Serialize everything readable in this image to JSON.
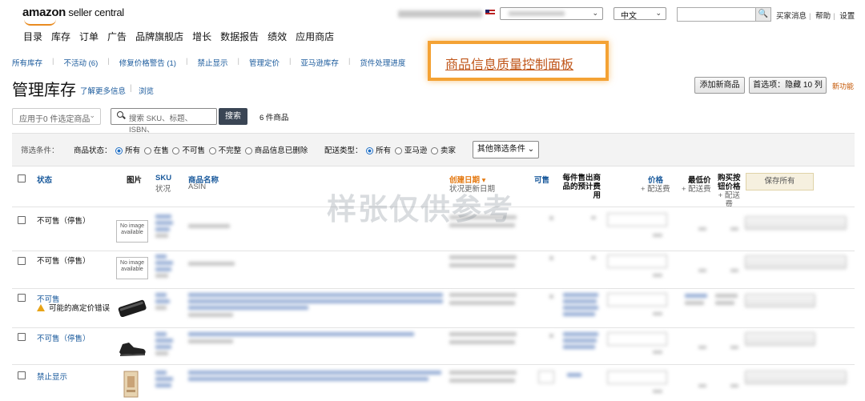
{
  "header": {
    "logo_main": "amazon",
    "logo_sub": " seller central",
    "nav": [
      "目录",
      "库存",
      "订单",
      "广告",
      "品牌旗舰店",
      "增长",
      "数据报告",
      "绩效",
      "应用商店"
    ],
    "lang_value": "中文",
    "top_links": [
      "买家消息",
      "帮助",
      "设置"
    ]
  },
  "subnav": [
    "所有库存",
    "不活动 (6)",
    "修复价格警告 (1)",
    "禁止显示",
    "管理定价",
    "亚马逊库存",
    "货件处理进度"
  ],
  "callout_text": "商品信息质量控制面板",
  "title": {
    "page_title": "管理库存",
    "learn_more": "了解更多信息",
    "browse": "浏览",
    "add_button": "添加新商品",
    "pref_button": "首选项：隐藏 10 列",
    "new_feature": "新功能"
  },
  "actions": {
    "apply_select": "应用于0 件选定商品",
    "search_placeholder": "搜索 SKU、标题、ISBN、",
    "search_button": "搜索",
    "count": "6 件商品"
  },
  "filters": {
    "label": "筛选条件：",
    "status_label": "商品状态：",
    "status_options": [
      "所有",
      "在售",
      "不可售",
      "不完整",
      "商品信息已删除"
    ],
    "fulfil_label": "配送类型：",
    "fulfil_options": [
      "所有",
      "亚马逊",
      "卖家"
    ],
    "more_button": "其他筛选条件"
  },
  "table": {
    "headers": {
      "status": "状态",
      "image": "图片",
      "sku": "SKU",
      "sku_sub": "状况",
      "name": "商品名称",
      "name_sub": "ASIN",
      "date": "创建日期 ▾",
      "date_sub": "状况更新日期",
      "available": "可售",
      "fee_1": "每件售出商",
      "fee_2": "品的预计费",
      "fee_3": "用",
      "price": "价格",
      "price_sub": "+ 配送费",
      "lowest": "最低价",
      "lowest_sub": "+ 配送费",
      "bb_1": "购买按",
      "bb_2": "钮价格",
      "bb_3": "+ 配送",
      "bb_4": "费",
      "save_all": "保存所有"
    },
    "rows": [
      {
        "status": "不可售（停售）",
        "warning": ""
      },
      {
        "status": "不可售（停售）",
        "warning": ""
      },
      {
        "status": "不可售",
        "warning": "可能的高定价错误"
      },
      {
        "status": "不可售（停售）",
        "warning": ""
      },
      {
        "status": "禁止显示",
        "warning": ""
      }
    ],
    "no_image_text": "No image available"
  },
  "watermark": "样张仅供参考",
  "colors": {
    "accent_orange": "#f4a234",
    "link_blue": "#1a5a9c",
    "dark_button": "#3a4554"
  }
}
